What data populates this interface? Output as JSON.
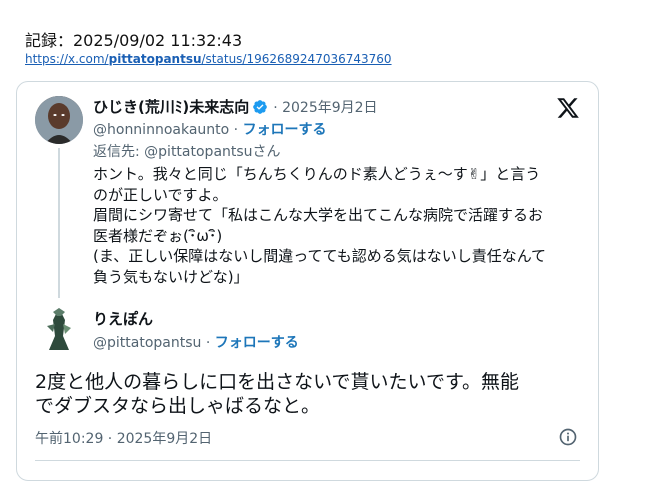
{
  "record": {
    "label": "記録：2025/09/02 11:32:43",
    "url_prefix": "https://x.com/",
    "url_user": "pittatopantsu",
    "url_suffix": "/status/1962689247036743760"
  },
  "quoted_tweet": {
    "display_name": "ひじき(荒川ﾐ)未来志向",
    "date": "· 2025年9月2日",
    "handle": "@honninnoakaunto ·",
    "follow_label": "フォローする",
    "reply_to": "返信先: @pittatopantsuさん",
    "body_lines": [
      "ホント。我々と同じ「ちんちくりんのド素人どうぇ～す✌」と言う",
      "のが正しいですよ。",
      "眉間にシワ寄せて「私はこんな大学を出てこんな病院で活躍するお",
      "医者様だぞぉ(･ิω･ิ)",
      "(ま、正しい保障はないし間違ってても認める気はないし責任なんて",
      "負う気もないけどな)」"
    ]
  },
  "main_tweet": {
    "display_name": "りえぽん",
    "handle": "@pittatopantsu ·",
    "follow_label": "フォローする",
    "body_lines": [
      "2度と他人の暮らしに口を出さないで貰いたいです。無能",
      "でダブスタなら出しゃばるなと。"
    ],
    "timestamp": "午前10:29 · 2025年9月2日"
  },
  "icons": {
    "verified": "verified-badge-icon",
    "x_logo": "x-logo-icon",
    "info": "info-icon"
  },
  "colors": {
    "link": "#1d76b9",
    "verified": "#1d9bf0",
    "muted": "#536471",
    "border": "#cfd9de"
  }
}
